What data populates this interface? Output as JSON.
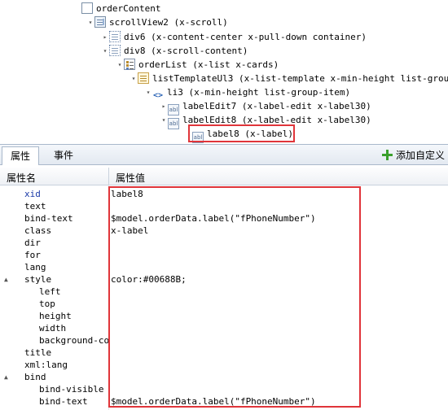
{
  "tree": {
    "nodes": [
      {
        "label": "orderContent",
        "icon": "box-icon",
        "expander": ""
      },
      {
        "label": "scrollView2 (x-scroll)",
        "icon": "scroll-icon",
        "expander": "▾"
      },
      {
        "label": "div6 (x-content-center x-pull-down container)",
        "icon": "div-icon",
        "expander": "▸"
      },
      {
        "label": "div8 (x-scroll-content)",
        "icon": "div-icon",
        "expander": "▾"
      },
      {
        "label": "orderList (x-list x-cards)",
        "icon": "list-icon",
        "expander": "▾"
      },
      {
        "label": "listTemplateUl3 (x-list-template x-min-height list-group)",
        "icon": "template-icon",
        "expander": "▾"
      },
      {
        "label": "li3 (x-min-height list-group-item)",
        "icon": "code-icon",
        "expander": "▾"
      },
      {
        "label": "labelEdit7 (x-label-edit x-label30)",
        "icon": "label-icon",
        "expander": "▸"
      },
      {
        "label": "labelEdit8 (x-label-edit x-label30)",
        "icon": "label-icon",
        "expander": "▾"
      },
      {
        "label": "label8 (x-label)",
        "icon": "label-icon",
        "expander": ""
      }
    ],
    "label_icon_text": "abl",
    "code_icon_text": "<>"
  },
  "tabs": {
    "properties": "属性",
    "events": "事件",
    "add_custom": "添加自定义"
  },
  "grid": {
    "header_name": "属性名",
    "header_value": "属性值",
    "rows": [
      {
        "name": "xid",
        "value": "label8"
      },
      {
        "name": "text",
        "value": ""
      },
      {
        "name": "bind-text",
        "value": "$model.orderData.label(\"fPhoneNumber\")"
      },
      {
        "name": "class",
        "value": "x-label"
      },
      {
        "name": "dir",
        "value": ""
      },
      {
        "name": "for",
        "value": ""
      },
      {
        "name": "lang",
        "value": ""
      },
      {
        "name": "style",
        "value": "color:#00688B;"
      },
      {
        "name": "left",
        "value": ""
      },
      {
        "name": "top",
        "value": ""
      },
      {
        "name": "height",
        "value": ""
      },
      {
        "name": "width",
        "value": ""
      },
      {
        "name": "background-col",
        "value": ""
      },
      {
        "name": "title",
        "value": ""
      },
      {
        "name": "xml:lang",
        "value": ""
      },
      {
        "name": "bind",
        "value": ""
      },
      {
        "name": "bind-visible",
        "value": ""
      },
      {
        "name": "bind-text",
        "value": "$model.orderData.label(\"fPhoneNumber\")"
      }
    ]
  },
  "colors": {
    "highlight_border": "#e0353a",
    "selected_name": "#1b3aa8",
    "add_icon": "#3aa02c"
  }
}
